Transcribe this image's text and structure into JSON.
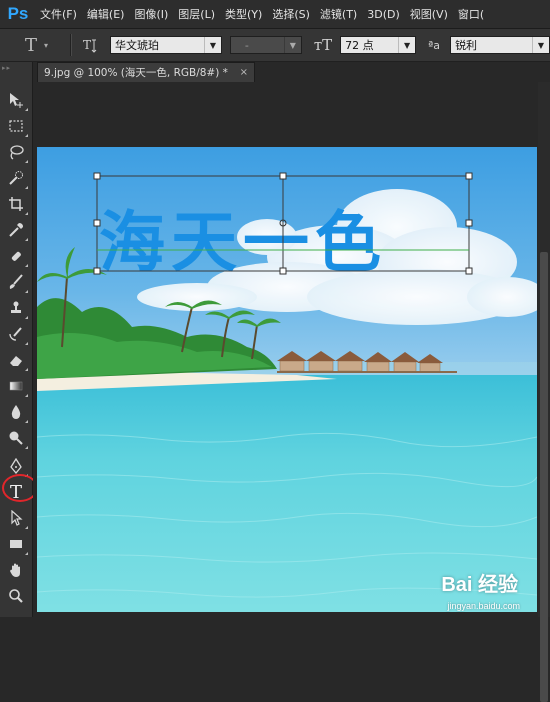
{
  "app": {
    "logo": "Ps"
  },
  "menu": [
    "文件(F)",
    "编辑(E)",
    "图像(I)",
    "图层(L)",
    "类型(Y)",
    "选择(S)",
    "滤镜(T)",
    "3D(D)",
    "视图(V)",
    "窗口("
  ],
  "options": {
    "tool_icon": "T",
    "orientation_icon": "text-orientation-icon",
    "font_family": "华文琥珀",
    "font_style": "-",
    "font_size": "72 点",
    "antialias_label": "ªa",
    "antialias": "锐利"
  },
  "document": {
    "tab_title": "9.jpg @ 100% (海天一色, RGB/8#) *",
    "close_symbol": "×"
  },
  "canvas": {
    "text_layer": "海天一色",
    "text_color": "#1a8fe3"
  },
  "toolbar": {
    "selected_tool": "type-tool",
    "highlight_color": "#e0262b",
    "type_tool_glyph": "T"
  },
  "watermark": {
    "brand": "Bai 经验",
    "url": "jingyan.baidu.com"
  }
}
